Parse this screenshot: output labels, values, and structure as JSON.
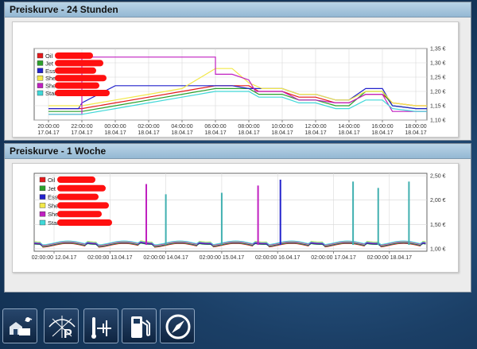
{
  "panels": {
    "day": {
      "title": "Preiskurve - 24 Stunden"
    },
    "week": {
      "title": "Preiskurve - 1 Woche"
    }
  },
  "chart_data": [
    {
      "type": "line",
      "title": "",
      "ylim": [
        1.1,
        1.35
      ],
      "y_ticks": [
        "1,35 €",
        "1,30 €",
        "1,25 €",
        "1,20 €",
        "1,15 €",
        "1,10 €"
      ],
      "x_ticks": [
        {
          "time": "20:00:00",
          "date": "17.04.17"
        },
        {
          "time": "22:00:00",
          "date": "17.04.17"
        },
        {
          "time": "00:00:00",
          "date": "18.04.17"
        },
        {
          "time": "02:00:00",
          "date": "18.04.17"
        },
        {
          "time": "04:00:00",
          "date": "18.04.17"
        },
        {
          "time": "06:00:00",
          "date": "18.04.17"
        },
        {
          "time": "08:00:00",
          "date": "18.04.17"
        },
        {
          "time": "10:00:00",
          "date": "18.04.17"
        },
        {
          "time": "12:00:00",
          "date": "18.04.17"
        },
        {
          "time": "14:00:00",
          "date": "18.04.17"
        },
        {
          "time": "16:00:00",
          "date": "18.04.17"
        },
        {
          "time": "18:00:00",
          "date": "18.04.17"
        }
      ],
      "grid": true,
      "legend_position": "top-left",
      "series": [
        {
          "name": "Oil",
          "color": "#e41a1c",
          "values": [
            [
              0,
              1.14
            ],
            [
              1,
              1.14
            ],
            [
              2,
              1.16
            ],
            [
              3,
              1.18
            ],
            [
              4,
              1.2
            ],
            [
              5,
              1.22
            ],
            [
              6,
              1.22
            ],
            [
              6.3,
              1.2
            ],
            [
              7,
              1.2
            ],
            [
              7.5,
              1.18
            ],
            [
              8,
              1.18
            ],
            [
              8.6,
              1.16
            ],
            [
              9,
              1.16
            ],
            [
              9.5,
              1.19
            ],
            [
              10,
              1.19
            ],
            [
              10.3,
              1.16
            ],
            [
              11,
              1.15
            ],
            [
              12,
              1.15
            ]
          ]
        },
        {
          "name": "Jet",
          "color": "#2ca02c",
          "values": [
            [
              0,
              1.13
            ],
            [
              1,
              1.13
            ],
            [
              2,
              1.15
            ],
            [
              3,
              1.17
            ],
            [
              4,
              1.19
            ],
            [
              5,
              1.21
            ],
            [
              6,
              1.21
            ],
            [
              6.3,
              1.19
            ],
            [
              7,
              1.19
            ],
            [
              7.5,
              1.17
            ],
            [
              8,
              1.17
            ],
            [
              8.6,
              1.15
            ],
            [
              9,
              1.15
            ],
            [
              9.5,
              1.2
            ],
            [
              10,
              1.2
            ],
            [
              10.3,
              1.15
            ],
            [
              11,
              1.14
            ],
            [
              12,
              1.14
            ]
          ]
        },
        {
          "name": "Esso",
          "color": "#2222cc",
          "values": [
            [
              0,
              1.14
            ],
            [
              0.9,
              1.14
            ],
            [
              1,
              1.16
            ],
            [
              2,
              1.22
            ],
            [
              5,
              1.22
            ],
            [
              5.5,
              1.22
            ],
            [
              6,
              1.21
            ],
            [
              6.3,
              1.21
            ],
            [
              7,
              1.21
            ],
            [
              7.5,
              1.19
            ],
            [
              8,
              1.19
            ],
            [
              8.6,
              1.17
            ],
            [
              9,
              1.17
            ],
            [
              9.5,
              1.21
            ],
            [
              10,
              1.21
            ],
            [
              10.3,
              1.15
            ],
            [
              11,
              1.14
            ],
            [
              12,
              1.14
            ]
          ]
        },
        {
          "name": "Shell",
          "color": "#f2e84a",
          "values": [
            [
              0,
              1.15
            ],
            [
              1,
              1.15
            ],
            [
              2,
              1.17
            ],
            [
              3,
              1.19
            ],
            [
              4,
              1.21
            ],
            [
              5,
              1.28
            ],
            [
              5.5,
              1.28
            ],
            [
              6,
              1.23
            ],
            [
              6.4,
              1.21
            ],
            [
              7,
              1.21
            ],
            [
              7.5,
              1.19
            ],
            [
              8,
              1.19
            ],
            [
              8.6,
              1.17
            ],
            [
              9,
              1.17
            ],
            [
              9.5,
              1.2
            ],
            [
              10,
              1.2
            ],
            [
              10.3,
              1.16
            ],
            [
              11,
              1.15
            ],
            [
              12,
              1.15
            ]
          ]
        },
        {
          "name": "Shell",
          "color": "#c020c0",
          "values": [
            [
              0,
              1.12
            ],
            [
              1,
              1.12
            ],
            [
              1,
              1.32
            ],
            [
              5,
              1.32
            ],
            [
              5,
              1.26
            ],
            [
              5.5,
              1.26
            ],
            [
              6,
              1.24
            ],
            [
              6.2,
              1.2
            ],
            [
              7,
              1.2
            ],
            [
              7.5,
              1.17
            ],
            [
              8,
              1.17
            ],
            [
              8.6,
              1.16
            ],
            [
              9,
              1.16
            ],
            [
              9.5,
              1.19
            ],
            [
              10,
              1.19
            ],
            [
              10.3,
              1.13
            ],
            [
              11,
              1.13
            ],
            [
              12,
              1.13
            ]
          ]
        },
        {
          "name": "Star",
          "color": "#40d8d8",
          "values": [
            [
              0,
              1.12
            ],
            [
              1,
              1.12
            ],
            [
              2,
              1.14
            ],
            [
              3,
              1.16
            ],
            [
              4,
              1.18
            ],
            [
              5,
              1.2
            ],
            [
              6,
              1.2
            ],
            [
              6.3,
              1.18
            ],
            [
              7,
              1.18
            ],
            [
              7.5,
              1.16
            ],
            [
              8,
              1.16
            ],
            [
              8.6,
              1.14
            ],
            [
              9,
              1.14
            ],
            [
              9.5,
              1.17
            ],
            [
              10,
              1.17
            ],
            [
              10.3,
              1.14
            ],
            [
              11,
              1.13
            ],
            [
              12,
              1.13
            ]
          ]
        }
      ]
    },
    {
      "type": "line",
      "title": "",
      "ylim": [
        0.95,
        2.55
      ],
      "y_ticks": [
        "2,50 €",
        "2,00 €",
        "1,50 €",
        "1,00 €"
      ],
      "x_ticks": [
        {
          "time": "02:00:00",
          "date": "12.04.17"
        },
        {
          "time": "02:00:00",
          "date": "13.04.17"
        },
        {
          "time": "02:00:00",
          "date": "14.04.17"
        },
        {
          "time": "02:00:00",
          "date": "15.04.17"
        },
        {
          "time": "02:00:00",
          "date": "16.04.17"
        },
        {
          "time": "02:00:00",
          "date": "17.04.17"
        },
        {
          "time": "02:00:00",
          "date": "18.04.17"
        }
      ],
      "grid": true,
      "legend_position": "top-left",
      "spikes": [
        {
          "day": 2.6,
          "value": 2.33,
          "color": "#c020c0"
        },
        {
          "day": 2.95,
          "value": 2.12,
          "color": "#40b0b0"
        },
        {
          "day": 3.95,
          "value": 2.15,
          "color": "#40b0b0"
        },
        {
          "day": 4.6,
          "value": 2.3,
          "color": "#c020c0"
        },
        {
          "day": 5.0,
          "value": 2.42,
          "color": "#2222cc"
        },
        {
          "day": 6.3,
          "value": 2.38,
          "color": "#40b0b0"
        },
        {
          "day": 6.75,
          "value": 2.25,
          "color": "#40b0b0"
        },
        {
          "day": 7.3,
          "value": 2.38,
          "color": "#40b0b0"
        }
      ],
      "series": [
        {
          "name": "Oil",
          "color": "#e41a1c"
        },
        {
          "name": "Jet",
          "color": "#2ca02c"
        },
        {
          "name": "Esso",
          "color": "#2222cc"
        },
        {
          "name": "Shell",
          "color": "#f2e84a"
        },
        {
          "name": "Shell",
          "color": "#c020c0"
        },
        {
          "name": "Star",
          "color": "#40d8d8"
        }
      ]
    }
  ],
  "toolbar": {
    "buttons": [
      {
        "icon": "house-weather-icon"
      },
      {
        "icon": "solar-parking-icon"
      },
      {
        "icon": "heating-thermometer-icon"
      },
      {
        "icon": "fuel-pump-icon"
      },
      {
        "icon": "compass-icon"
      }
    ]
  }
}
